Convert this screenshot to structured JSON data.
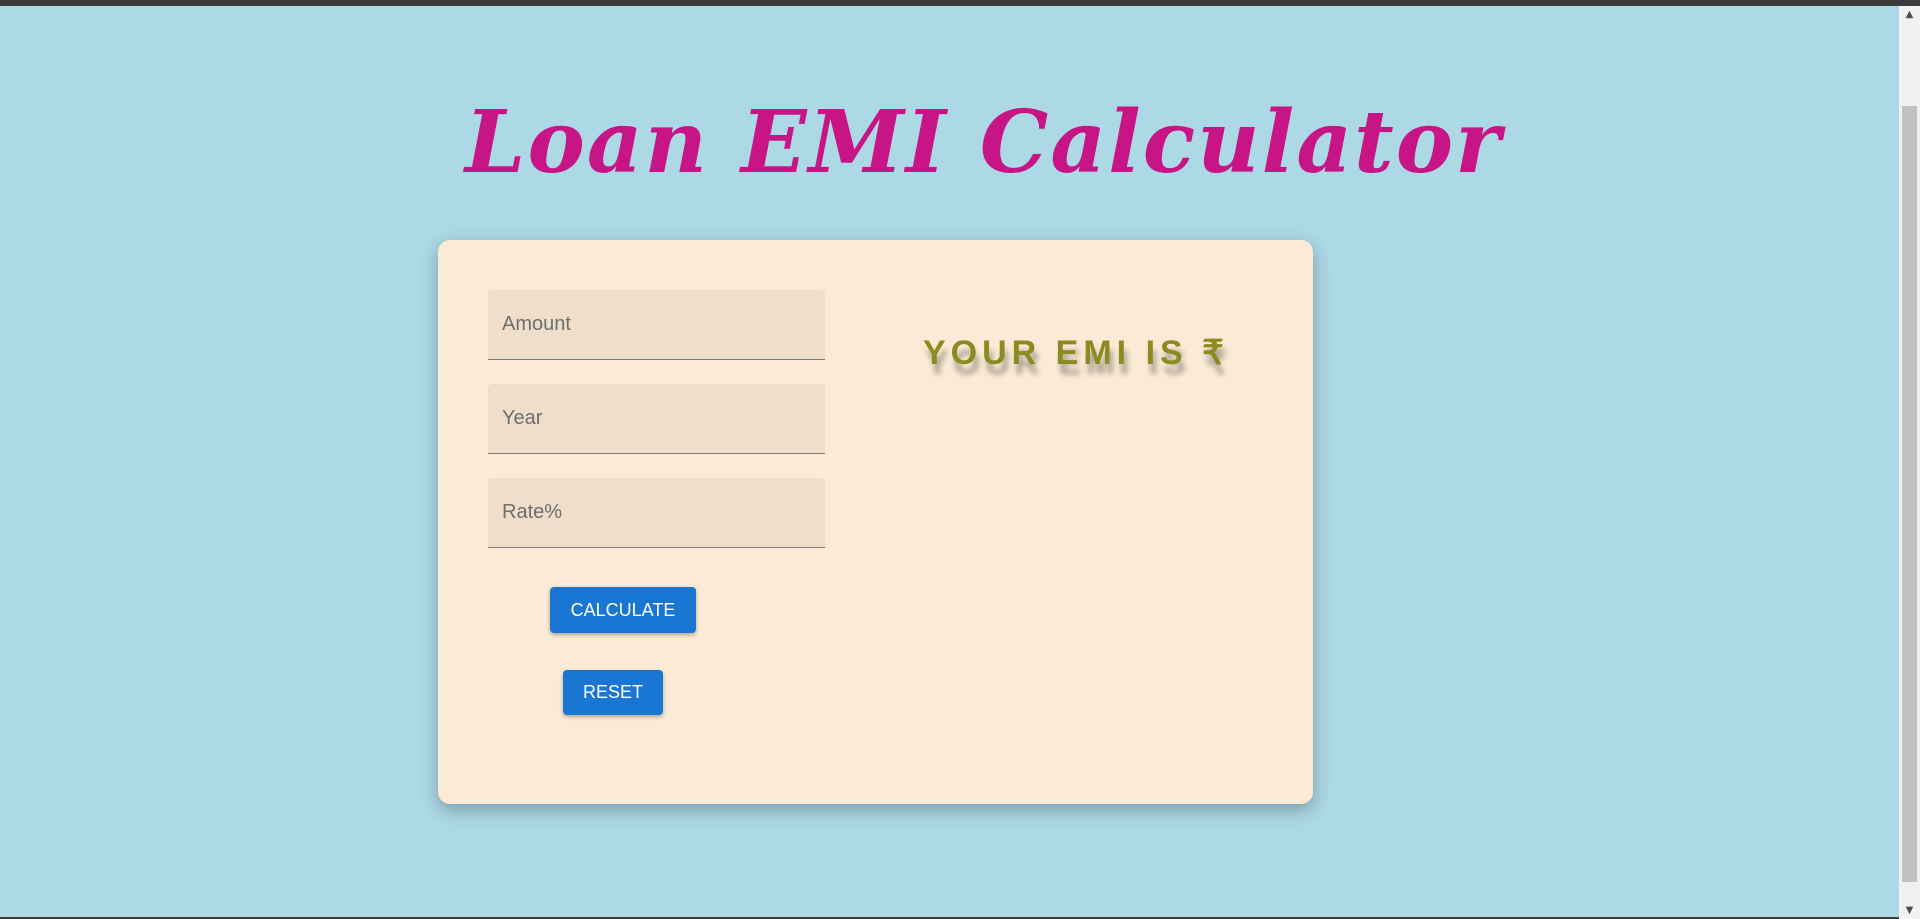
{
  "title": "Loan EMI Calculator",
  "form": {
    "amount_placeholder": "Amount",
    "year_placeholder": "Year",
    "rate_placeholder": "Rate%",
    "amount_value": "",
    "year_value": "",
    "rate_value": ""
  },
  "buttons": {
    "calculate_label": "CALCULATE",
    "reset_label": "RESET"
  },
  "result": {
    "label": "YOUR EMI IS ₹"
  },
  "icons": {
    "scroll_up": "arrow-up-icon",
    "scroll_down": "arrow-down-icon"
  },
  "colors": {
    "page_background": "#add8e6",
    "title": "#c71585",
    "card_background": "#fbebd6",
    "button": "#1976d2",
    "result_text": "#8b8b1f"
  }
}
